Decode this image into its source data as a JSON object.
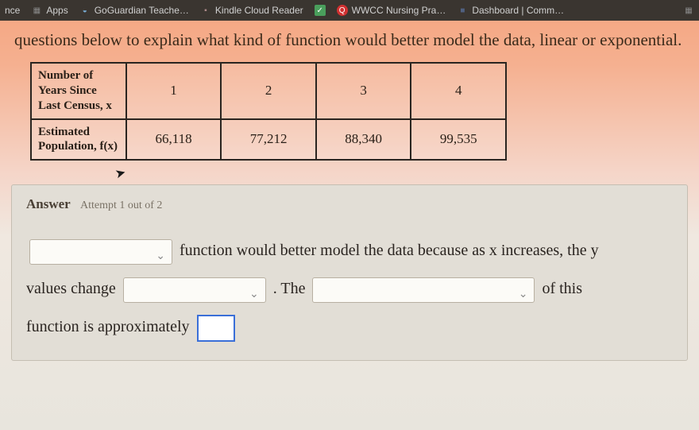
{
  "bookmarks": {
    "b0": "nce",
    "b1": "Apps",
    "b2": "GoGuardian Teache…",
    "b3": "Kindle Cloud Reader",
    "b4": "WWCC Nursing Pra…",
    "b5": "Dashboard | Comm…"
  },
  "question": {
    "text": "questions below to explain what kind of function would better model the data, linear or exponential."
  },
  "table": {
    "row1_label": "Number of Years Since Last Census, x",
    "row2_label": "Estimated Population, f(x)",
    "h1": "1",
    "h2": "2",
    "h3": "3",
    "h4": "4",
    "d1": "66,118",
    "d2": "77,212",
    "d3": "88,340",
    "d4": "99,535"
  },
  "chart_data": {
    "type": "table",
    "title": "Population since last census",
    "x_label": "Number of Years Since Last Census, x",
    "y_label": "Estimated Population, f(x)",
    "x": [
      1,
      2,
      3,
      4
    ],
    "y": [
      66118,
      77212,
      88340,
      99535
    ]
  },
  "answer": {
    "heading": "Answer",
    "attempt": "Attempt 1 out of 2",
    "seg1": "function would better model the data because as x increases, the y",
    "seg2": "values change",
    "seg3": ". The",
    "seg4": "of this",
    "seg5": "function is approximately",
    "numbox_value": ""
  }
}
